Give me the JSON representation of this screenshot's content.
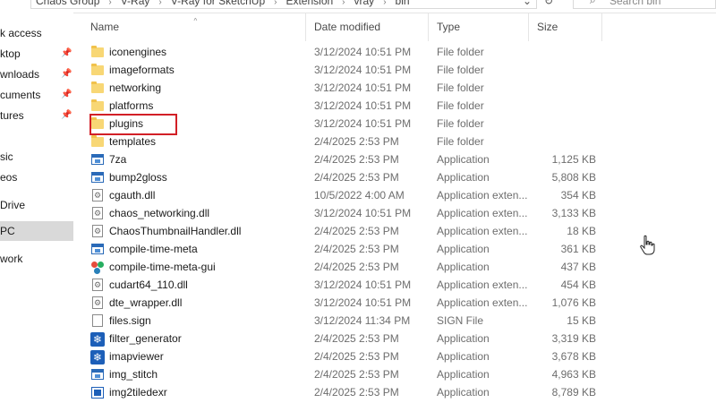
{
  "address": {
    "crumbs": [
      "Chaos Group",
      "V-Ray",
      "V-Ray for SketchUp",
      "Extension",
      "vray",
      "bin"
    ],
    "search_placeholder": "Search bin"
  },
  "nav": {
    "items": [
      {
        "label": "k access",
        "pinned": false
      },
      {
        "label": "ktop",
        "pinned": true
      },
      {
        "label": "wnloads",
        "pinned": true
      },
      {
        "label": "cuments",
        "pinned": true
      },
      {
        "label": "tures",
        "pinned": true
      },
      {
        "label": "sic",
        "pinned": false
      },
      {
        "label": "eos",
        "pinned": false
      },
      {
        "label": "Drive",
        "pinned": false
      },
      {
        "label": "PC",
        "pinned": false,
        "selected": true
      },
      {
        "label": "work",
        "pinned": false
      }
    ]
  },
  "columns": {
    "name": "Name",
    "date": "Date modified",
    "type": "Type",
    "size": "Size"
  },
  "files": [
    {
      "name": "iconengines",
      "date": "3/12/2024 10:51 PM",
      "type": "File folder",
      "size": "",
      "icon": "folder"
    },
    {
      "name": "imageformats",
      "date": "3/12/2024 10:51 PM",
      "type": "File folder",
      "size": "",
      "icon": "folder"
    },
    {
      "name": "networking",
      "date": "3/12/2024 10:51 PM",
      "type": "File folder",
      "size": "",
      "icon": "folder"
    },
    {
      "name": "platforms",
      "date": "3/12/2024 10:51 PM",
      "type": "File folder",
      "size": "",
      "icon": "folder"
    },
    {
      "name": "plugins",
      "date": "3/12/2024 10:51 PM",
      "type": "File folder",
      "size": "",
      "icon": "folder"
    },
    {
      "name": "templates",
      "date": "2/4/2025 2:53 PM",
      "type": "File folder",
      "size": "",
      "icon": "folder"
    },
    {
      "name": "7za",
      "date": "2/4/2025 2:53 PM",
      "type": "Application",
      "size": "1,125 KB",
      "icon": "app"
    },
    {
      "name": "bump2gloss",
      "date": "2/4/2025 2:53 PM",
      "type": "Application",
      "size": "5,808 KB",
      "icon": "app"
    },
    {
      "name": "cgauth.dll",
      "date": "10/5/2022 4:00 AM",
      "type": "Application exten...",
      "size": "354 KB",
      "icon": "dll"
    },
    {
      "name": "chaos_networking.dll",
      "date": "3/12/2024 10:51 PM",
      "type": "Application exten...",
      "size": "3,133 KB",
      "icon": "dll"
    },
    {
      "name": "ChaosThumbnailHandler.dll",
      "date": "2/4/2025 2:53 PM",
      "type": "Application exten...",
      "size": "18 KB",
      "icon": "dll"
    },
    {
      "name": "compile-time-meta",
      "date": "2/4/2025 2:53 PM",
      "type": "Application",
      "size": "361 KB",
      "icon": "app"
    },
    {
      "name": "compile-time-meta-gui",
      "date": "2/4/2025 2:53 PM",
      "type": "Application",
      "size": "437 KB",
      "icon": "gui"
    },
    {
      "name": "cudart64_110.dll",
      "date": "3/12/2024 10:51 PM",
      "type": "Application exten...",
      "size": "454 KB",
      "icon": "dll"
    },
    {
      "name": "dte_wrapper.dll",
      "date": "3/12/2024 10:51 PM",
      "type": "Application exten...",
      "size": "1,076 KB",
      "icon": "dll"
    },
    {
      "name": "files.sign",
      "date": "3/12/2024 11:34 PM",
      "type": "SIGN File",
      "size": "15 KB",
      "icon": "file"
    },
    {
      "name": "filter_generator",
      "date": "2/4/2025 2:53 PM",
      "type": "Application",
      "size": "3,319 KB",
      "icon": "snow"
    },
    {
      "name": "imapviewer",
      "date": "2/4/2025 2:53 PM",
      "type": "Application",
      "size": "3,678 KB",
      "icon": "snow"
    },
    {
      "name": "img_stitch",
      "date": "2/4/2025 2:53 PM",
      "type": "Application",
      "size": "4,963 KB",
      "icon": "app"
    },
    {
      "name": "img2tiledexr",
      "date": "2/4/2025 2:53 PM",
      "type": "Application",
      "size": "8,789 KB",
      "icon": "img2"
    }
  ]
}
